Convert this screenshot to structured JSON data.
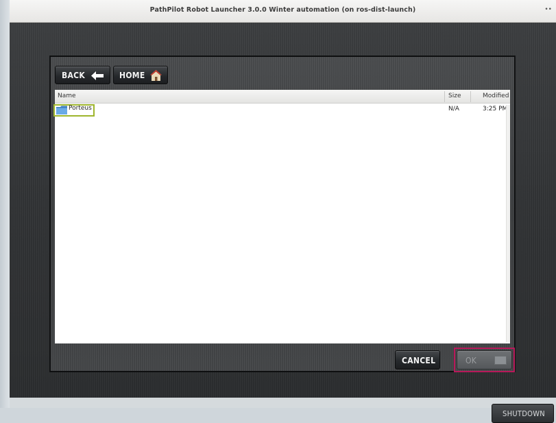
{
  "window": {
    "title": "PathPilot Robot Launcher 3.0.0 Winter automation (on ros-dist-launch)",
    "menu_icon": "menu-icon"
  },
  "nav": {
    "back_label": "BACK",
    "back_icon": "arrow-left-icon",
    "home_label": "HOME",
    "home_icon": "house-icon"
  },
  "file_list": {
    "columns": [
      "Name",
      "Size",
      "Modified"
    ],
    "rows": [
      {
        "name": "Porteus",
        "size": "N/A",
        "modified": "3:25 PM",
        "icon": "folder-icon"
      }
    ]
  },
  "actions": {
    "cancel_label": "CANCEL",
    "ok_label": "OK",
    "shutdown_label": "SHUTDOWN"
  },
  "colors": {
    "selection_highlight": "#9eb52b",
    "ok_highlight": "#b8195a",
    "folder": "#5b9bd5"
  }
}
